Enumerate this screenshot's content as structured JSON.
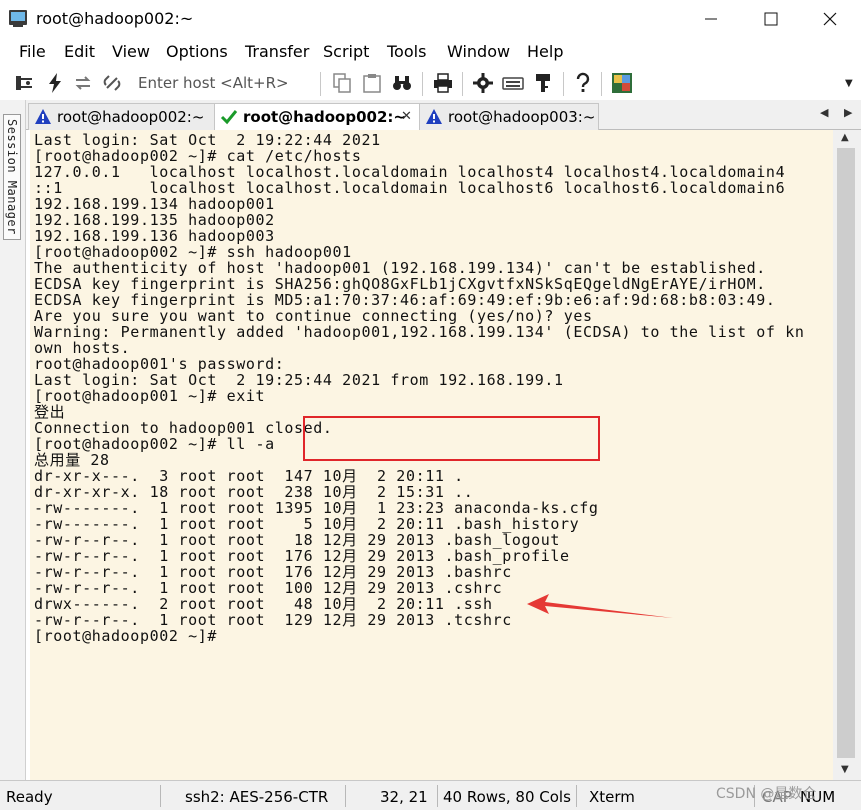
{
  "window": {
    "title": "root@hadoop002:~"
  },
  "menu": [
    "File",
    "Edit",
    "View",
    "Options",
    "Transfer",
    "Script",
    "Tools",
    "Window",
    "Help"
  ],
  "toolbar": {
    "host_placeholder": "Enter host <Alt+R>"
  },
  "session_manager": {
    "label": "Session Manager"
  },
  "tabs": [
    {
      "label": "root@hadoop002:~",
      "status": "warning",
      "active": false
    },
    {
      "label": "root@hadoop002:~",
      "status": "connected",
      "active": true
    },
    {
      "label": "root@hadoop003:~",
      "status": "warning",
      "active": false
    }
  ],
  "terminal": {
    "lines": [
      "Last login: Sat Oct  2 19:22:44 2021",
      "[root@hadoop002 ~]# cat /etc/hosts",
      "127.0.0.1   localhost localhost.localdomain localhost4 localhost4.localdomain4",
      "::1         localhost localhost.localdomain localhost6 localhost6.localdomain6",
      "192.168.199.134 hadoop001",
      "192.168.199.135 hadoop002",
      "192.168.199.136 hadoop003",
      "[root@hadoop002 ~]# ssh hadoop001",
      "The authenticity of host 'hadoop001 (192.168.199.134)' can't be established.",
      "ECDSA key fingerprint is SHA256:ghQO8GxFLb1jCXgvtfxNSkSqEQgeldNgErAYE/irHOM.",
      "ECDSA key fingerprint is MD5:a1:70:37:46:af:69:49:ef:9b:e6:af:9d:68:b8:03:49.",
      "Are you sure you want to continue connecting (yes/no)? yes",
      "Warning: Permanently added 'hadoop001,192.168.199.134' (ECDSA) to the list of kn",
      "own hosts.",
      "root@hadoop001's password:",
      "Last login: Sat Oct  2 19:25:44 2021 from 192.168.199.1",
      "[root@hadoop001 ~]# exit",
      "登出",
      "Connection to hadoop001 closed.",
      "[root@hadoop002 ~]# ll -a",
      "总用量 28",
      "dr-xr-x---.  3 root root  147 10月  2 20:11 .",
      "dr-xr-xr-x. 18 root root  238 10月  2 15:31 ..",
      "-rw-------.  1 root root 1395 10月  1 23:23 anaconda-ks.cfg",
      "-rw-------.  1 root root    5 10月  2 20:11 .bash_history",
      "-rw-r--r--.  1 root root   18 12月 29 2013 .bash_logout",
      "-rw-r--r--.  1 root root  176 12月 29 2013 .bash_profile",
      "-rw-r--r--.  1 root root  176 12月 29 2013 .bashrc",
      "-rw-r--r--.  1 root root  100 12月 29 2013 .cshrc",
      "drwx------.  2 root root   48 10月  2 20:11 .ssh",
      "-rw-r--r--.  1 root root  129 12月 29 2013 .tcshrc",
      "[root@hadoop002 ~]#"
    ]
  },
  "status": {
    "ready": "Ready",
    "cipher": "ssh2: AES-256-CTR",
    "cursor_pos": "32, 21",
    "size": "40 Rows, 80 Cols",
    "emulation": "Xterm",
    "caps": "CAP",
    "num": "NUM"
  },
  "watermark": "CSDN @是数仓"
}
